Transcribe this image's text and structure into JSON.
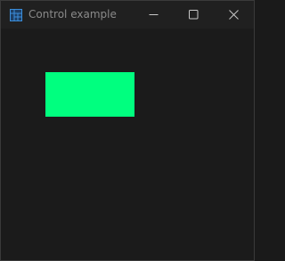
{
  "window": {
    "title": "Control example",
    "app_icon": "window-grid-icon",
    "controls": {
      "minimize_icon": "minimize-icon",
      "maximize_icon": "maximize-icon",
      "close_icon": "close-icon"
    }
  },
  "colors": {
    "background": "#1b1b1b",
    "titlebar": "#202020",
    "title_text": "#8a8a8a",
    "app_icon": "#3b8edb",
    "control_glyph": "#c8c8c8",
    "control_rect": "#00ff7f"
  }
}
